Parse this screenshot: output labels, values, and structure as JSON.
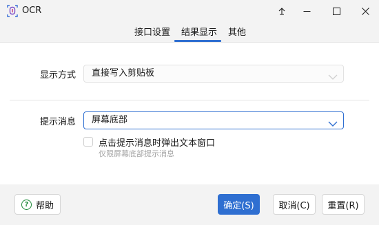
{
  "window": {
    "title": "OCR",
    "icons": {
      "app": "ocr-scan-icon",
      "pin": "pin-icon",
      "minimize": "minimize-icon",
      "maximize": "maximize-icon",
      "close": "close-icon"
    }
  },
  "tabs": [
    {
      "label": "接口设置",
      "selected": false
    },
    {
      "label": "结果显示",
      "selected": true
    },
    {
      "label": "其他",
      "selected": false
    }
  ],
  "display_mode": {
    "label": "显示方式",
    "value": "直接写入剪贴板",
    "enabled": false
  },
  "notification": {
    "label": "提示消息",
    "value": "屏幕底部",
    "checkbox_label": "点击提示消息时弹出文本窗口",
    "checkbox_checked": false,
    "hint": "仅限屏幕底部提示消息"
  },
  "footer": {
    "help": "帮助",
    "ok": "确定(S)",
    "cancel": "取消(C)",
    "reset": "重置(R)"
  },
  "colors": {
    "accent": "#2f6fd1",
    "help_icon": "#1e8a3a"
  }
}
